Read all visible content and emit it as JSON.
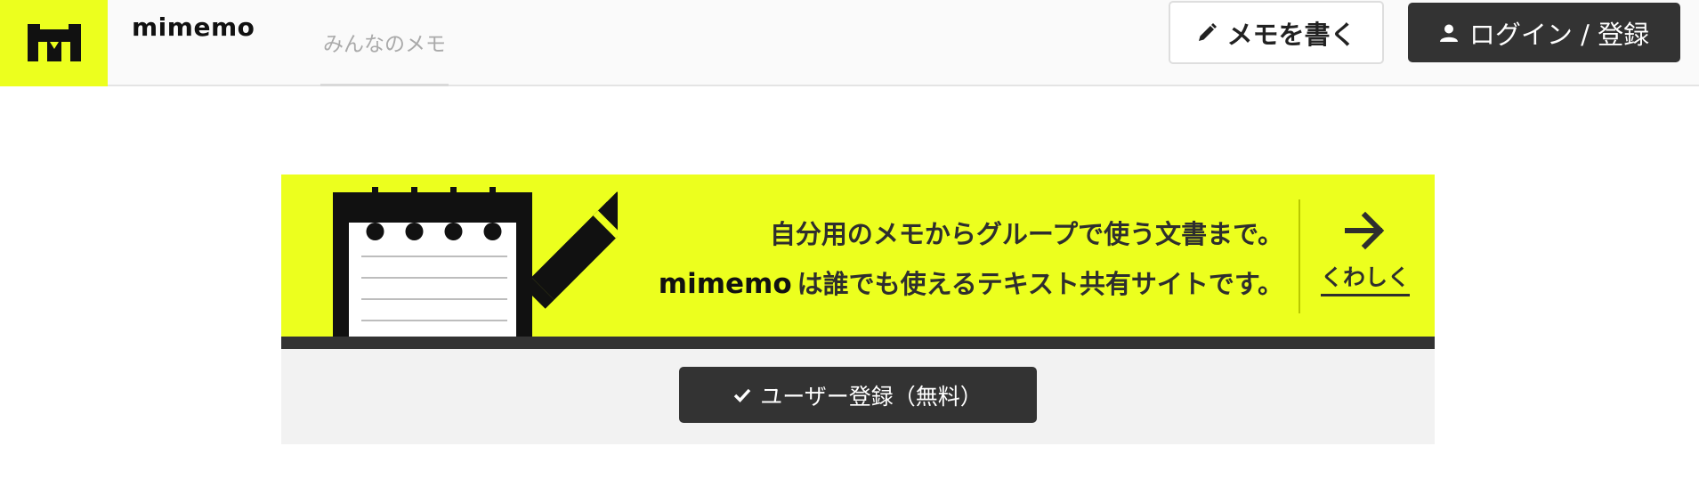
{
  "header": {
    "brand": "mimemo",
    "nav_tab": "みんなのメモ",
    "write_button": "メモを書く",
    "login_button": "ログイン / 登録"
  },
  "hero": {
    "line1": "自分用のメモからグループで使う文書まで。",
    "line2_brand": "mimemo",
    "line2_text": "は誰でも使えるテキスト共有サイトです。",
    "more_label": "くわしく",
    "signup_button": "ユーザー登録（無料）"
  },
  "colors": {
    "accent_yellow": "#ecff1e",
    "dark": "#333333",
    "light_gray": "#f2f2f2"
  },
  "icons": {
    "logo": "mimemo-logo-icon",
    "write": "pencil-icon",
    "login": "user-icon",
    "more": "arrow-right-icon",
    "signup": "check-icon",
    "illustration": "notepad-pencil-illustration"
  }
}
